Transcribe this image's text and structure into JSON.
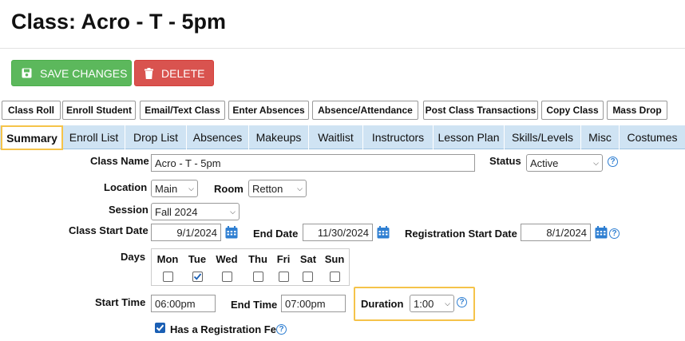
{
  "page": {
    "title": "Class: Acro - T - 5pm"
  },
  "actions": {
    "save_label": "SAVE CHANGES",
    "delete_label": "DELETE"
  },
  "toolbar": [
    "Class Roll",
    "Enroll Student",
    "Email/Text Class",
    "Enter Absences",
    "Absence/Attendance",
    "Post Class Transactions",
    "Copy Class",
    "Mass Drop"
  ],
  "tabs": [
    "Summary",
    "Enroll List",
    "Drop List",
    "Absences",
    "Makeups",
    "Waitlist",
    "Instructors",
    "Lesson Plan",
    "Skills/Levels",
    "Misc",
    "Costumes"
  ],
  "form": {
    "class_name": {
      "label": "Class Name",
      "value": "Acro - T - 5pm"
    },
    "status": {
      "label": "Status",
      "value": "Active"
    },
    "location": {
      "label": "Location",
      "value": "Main"
    },
    "room": {
      "label": "Room",
      "value": "Retton"
    },
    "session": {
      "label": "Session",
      "value": "Fall 2024"
    },
    "class_start_date": {
      "label": "Class Start Date",
      "value": "9/1/2024"
    },
    "end_date": {
      "label": "End Date",
      "value": "11/30/2024"
    },
    "registration_start_date": {
      "label": "Registration Start Date",
      "value": "8/1/2024"
    },
    "days": {
      "label": "Days",
      "names": [
        "Mon",
        "Tue",
        "Wed",
        "Thu",
        "Fri",
        "Sat",
        "Sun"
      ],
      "checked": [
        false,
        true,
        false,
        false,
        false,
        false,
        false
      ]
    },
    "start_time": {
      "label": "Start Time",
      "value": "06:00pm"
    },
    "end_time": {
      "label": "End Time",
      "value": "07:00pm"
    },
    "duration": {
      "label": "Duration",
      "value": "1:00"
    },
    "registration_fee": {
      "label": "Has a Registration Fee",
      "checked": true
    }
  },
  "colors": {
    "save": "#5cb85c",
    "delete": "#d9534f",
    "tab_bar": "#cfe3f3",
    "highlight": "#f5c34a",
    "help": "#2f7fd2"
  }
}
